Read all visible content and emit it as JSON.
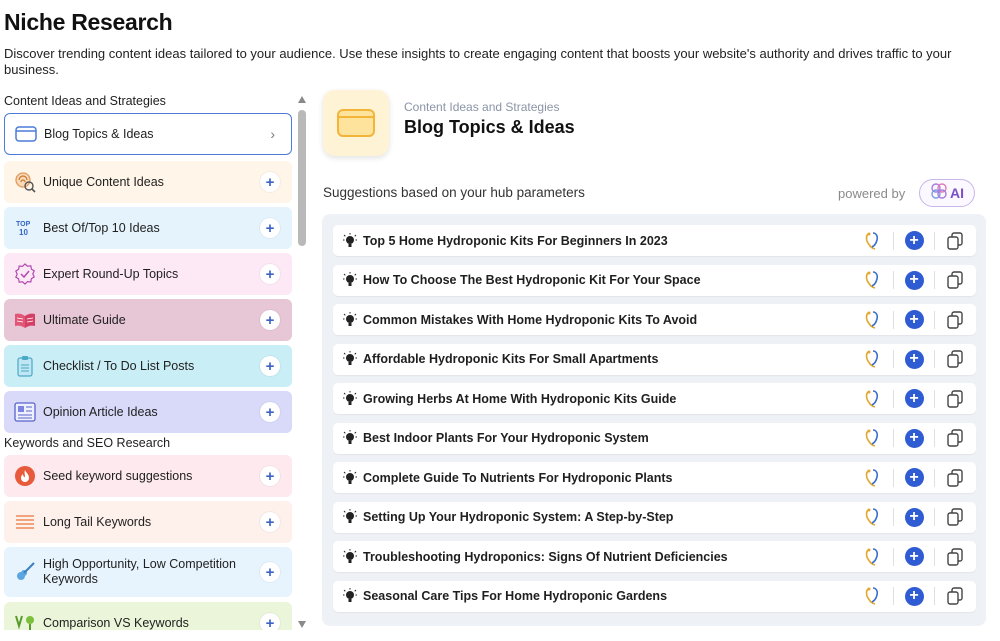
{
  "page": {
    "title": "Niche Research",
    "description": "Discover trending content ideas tailored to your audience. Use these insights to create engaging content that boosts your website's authority and drives traffic to your business."
  },
  "sidebar": {
    "sections": [
      {
        "label": "Content Ideas and Strategies"
      },
      {
        "label": "Keywords and SEO Research"
      }
    ],
    "items": [
      {
        "label": "Blog Topics & Ideas",
        "icon": "browser-window-icon",
        "bg": "#ffffff",
        "action": "chevron",
        "active": true
      },
      {
        "label": "Unique Content Ideas",
        "icon": "fingerprint-search-icon",
        "bg": "#fff5e8",
        "action": "plus"
      },
      {
        "label": "Best Of/Top 10 Ideas",
        "icon": "top-10-icon",
        "bg": "#e5f3fc",
        "action": "plus"
      },
      {
        "label": "Expert Round-Up Topics",
        "icon": "badge-check-icon",
        "bg": "#fde9f6",
        "action": "plus"
      },
      {
        "label": "Ultimate Guide",
        "icon": "open-book-icon",
        "bg": "#e7c6d5",
        "action": "plus"
      },
      {
        "label": "Checklist / To Do List Posts",
        "icon": "clipboard-icon",
        "bg": "#c9eef5",
        "action": "plus"
      },
      {
        "label": "Opinion Article Ideas",
        "icon": "newspaper-icon",
        "bg": "#d9d9fa",
        "action": "plus"
      },
      {
        "label": "Seed keyword suggestions",
        "icon": "flame-icon",
        "bg": "#fde9ee",
        "action": "plus"
      },
      {
        "label": "Long Tail Keywords",
        "icon": "lines-icon",
        "bg": "#fef0ea",
        "action": "plus"
      },
      {
        "label": "High Opportunity, Low Competition Keywords",
        "icon": "guitar-icon",
        "bg": "#e8f4fd",
        "action": "plus"
      },
      {
        "label": "Comparison VS Keywords",
        "icon": "versus-icon",
        "bg": "#eaf5da",
        "action": "plus"
      }
    ],
    "plus_symbol": "+",
    "chevron_symbol": "›"
  },
  "main": {
    "subtitle": "Content Ideas and Strategies",
    "title": "Blog Topics & Ideas",
    "suggestions_label": "Suggestions based on your hub parameters",
    "powered_by": "powered by",
    "ai_label": "AI",
    "add_symbol": "+",
    "suggestions": [
      "Top 5 Home Hydroponic Kits For Beginners In 2023",
      "How To Choose The Best Hydroponic Kit For Your Space",
      "Common Mistakes With Home Hydroponic Kits To Avoid",
      "Affordable Hydroponic Kits For Small Apartments",
      "Growing Herbs At Home With Hydroponic Kits Guide",
      "Best Indoor Plants For Your Hydroponic System",
      "Complete Guide To Nutrients For Hydroponic Plants",
      "Setting Up Your Hydroponic System: A Step-by-Step",
      "Troubleshooting Hydroponics: Signs Of Nutrient Deficiencies",
      "Seasonal Care Tips For Home Hydroponic Gardens"
    ]
  },
  "colors": {
    "accent": "#2f5bd3",
    "active_border": "#4c7bd9",
    "ai_purple": "#7a4fc7"
  }
}
